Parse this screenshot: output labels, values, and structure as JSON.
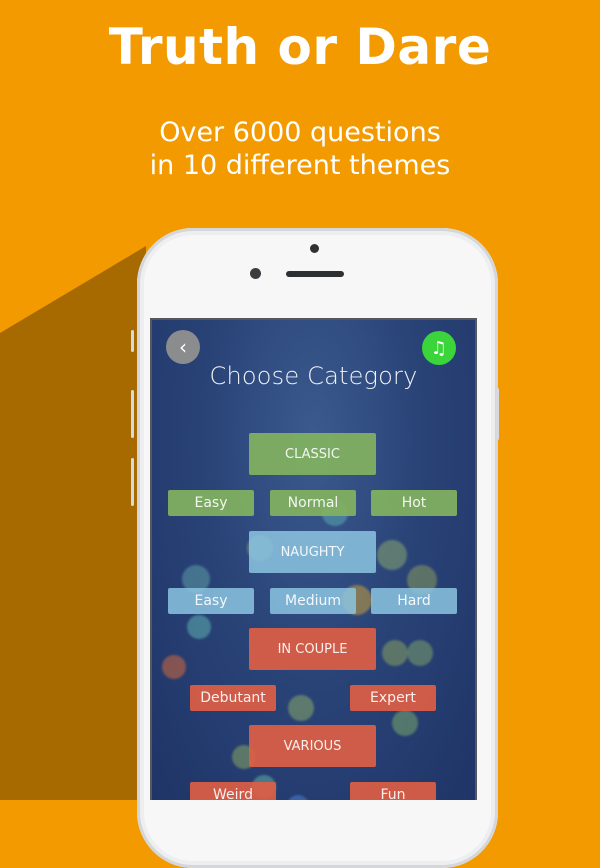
{
  "promo": {
    "title": "Truth or Dare",
    "subtitle_line1": "Over 6000 questions",
    "subtitle_line2": "in 10 different themes",
    "background_color": "#f39a00"
  },
  "screen": {
    "back_icon": "‹",
    "music_icon": "♫",
    "title": "Choose Category",
    "categories": [
      {
        "name": "CLASSIC",
        "color": "#82b260",
        "levels": [
          "Easy",
          "Normal",
          "Hot"
        ]
      },
      {
        "name": "NAUGHTY",
        "color": "#8cc4e0",
        "levels": [
          "Easy",
          "Medium",
          "Hard"
        ]
      },
      {
        "name": "IN COUPLE",
        "color": "#dd5e44",
        "levels": [
          "Debutant",
          "Expert"
        ]
      },
      {
        "name": "VARIOUS",
        "color": "#dd5e44",
        "levels": [
          "Weird",
          "Fun"
        ]
      }
    ]
  }
}
